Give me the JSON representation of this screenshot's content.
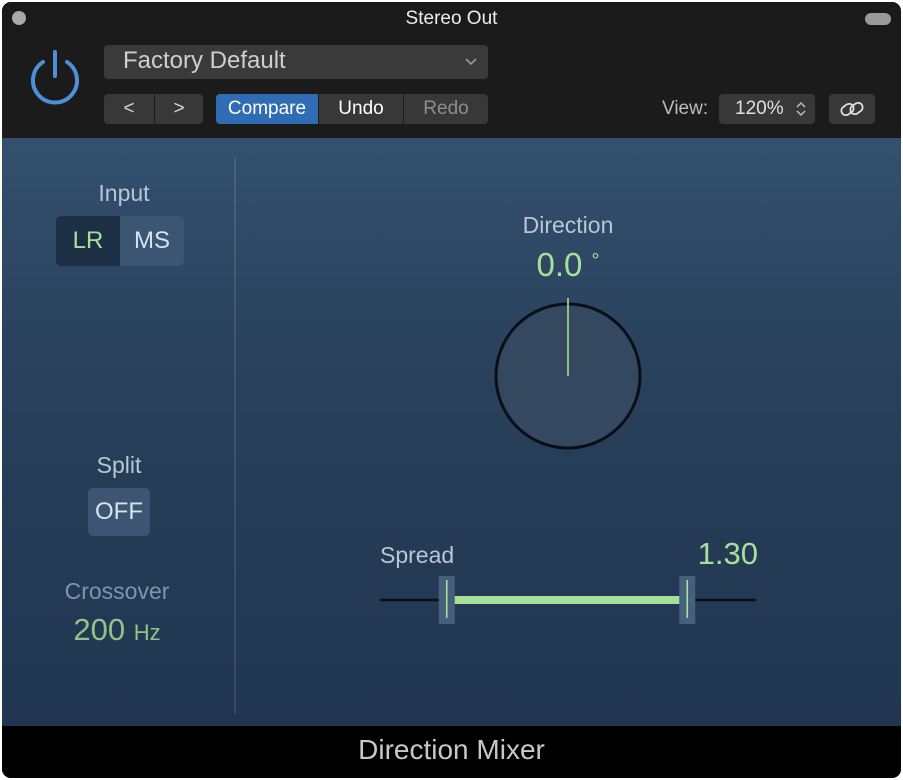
{
  "window": {
    "title": "Stereo Out"
  },
  "header": {
    "preset": "Factory Default",
    "nav_prev": "<",
    "nav_next": ">",
    "compare": "Compare",
    "undo": "Undo",
    "redo": "Redo",
    "view_label": "View:",
    "zoom": "120%"
  },
  "plugin": {
    "input": {
      "label": "Input",
      "options": [
        "LR",
        "MS"
      ],
      "selected": "LR"
    },
    "split": {
      "label": "Split",
      "value": "OFF"
    },
    "crossover": {
      "label": "Crossover",
      "value": "200",
      "unit": "Hz"
    },
    "direction": {
      "label": "Direction",
      "value": "0.0",
      "unit": "°"
    },
    "spread": {
      "label": "Spread",
      "value": "1.30",
      "range": [
        0.0,
        2.0
      ]
    },
    "name": "Direction Mixer"
  },
  "colors": {
    "accent_blue": "#2f6cb4",
    "value_green": "#a7e09a",
    "power_icon": "#4e8fd6"
  },
  "icons": {
    "power": "power-icon",
    "dropdown": "chevron-down-icon",
    "zoom_stepper": "up-down-arrows-icon",
    "link": "link-icon"
  }
}
